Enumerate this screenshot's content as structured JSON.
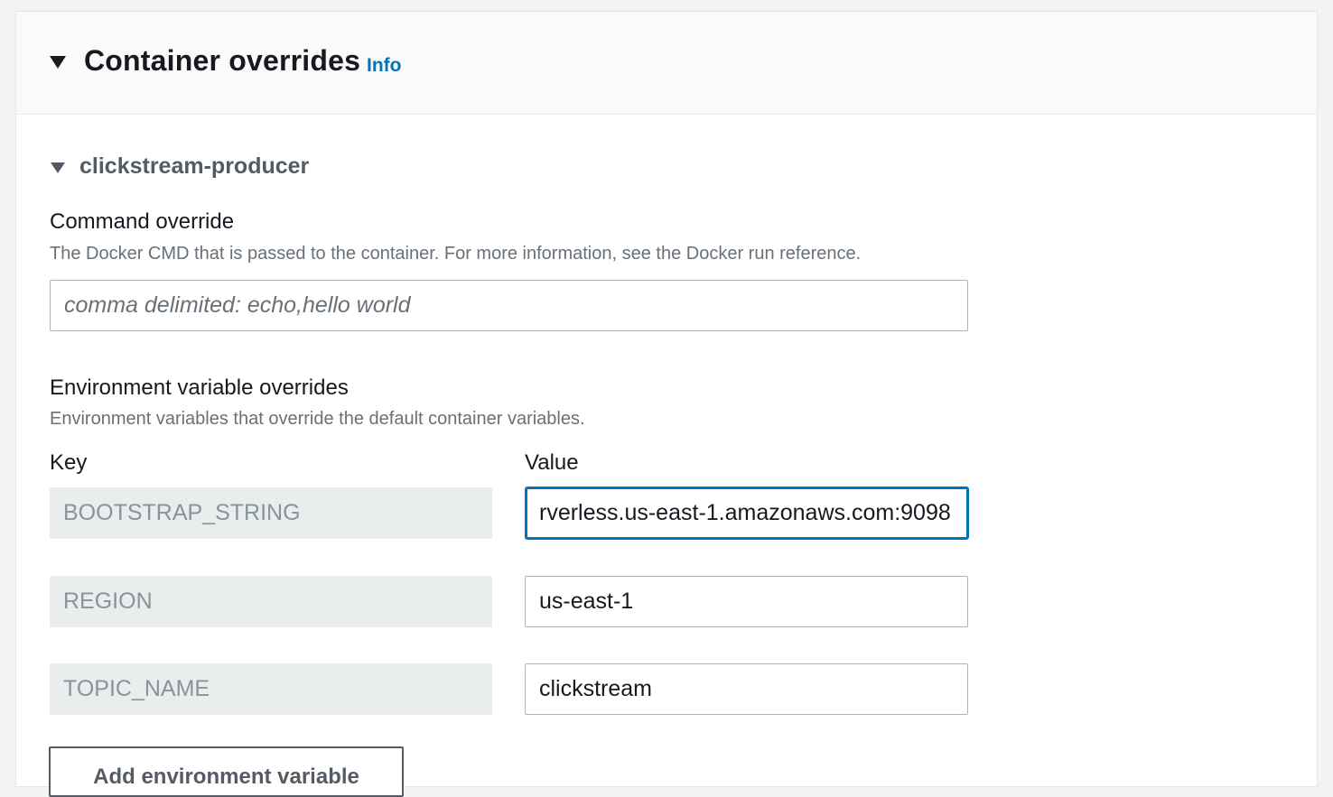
{
  "panel": {
    "title": "Container overrides",
    "info_label": "Info"
  },
  "container": {
    "name": "clickstream-producer"
  },
  "command": {
    "label": "Command override",
    "description": "The Docker CMD that is passed to the container. For more information, see the Docker run reference.",
    "placeholder": "comma delimited: echo,hello world",
    "value": ""
  },
  "env": {
    "label": "Environment variable overrides",
    "description": "Environment variables that override the default container variables.",
    "key_header": "Key",
    "value_header": "Value",
    "rows": [
      {
        "key": "BOOTSTRAP_STRING",
        "value": "rverless.us-east-1.amazonaws.com:9098"
      },
      {
        "key": "REGION",
        "value": "us-east-1"
      },
      {
        "key": "TOPIC_NAME",
        "value": "clickstream"
      }
    ],
    "add_button_label": "Add environment variable"
  }
}
